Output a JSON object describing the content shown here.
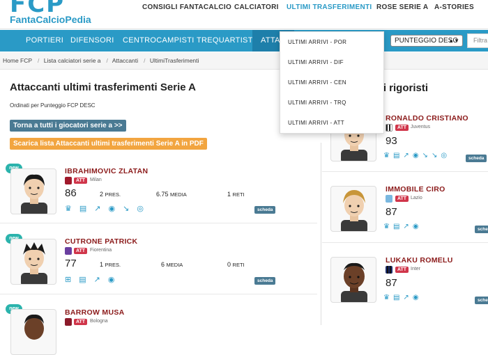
{
  "header": {
    "logo_mark": "FCP",
    "logo_text": "FantaCalcioPedia",
    "nav": [
      "CONSIGLI FANTACALCIO",
      "CALCIATORI",
      "ULTIMI TRASFERIMENTI",
      "ROSE SERIE A",
      "A-STORIES"
    ]
  },
  "positions": {
    "tabs": [
      "PORTIERI",
      "DIFENSORI",
      "CENTROCAMPISTI",
      "TREQUARTISTI",
      "ATTAC"
    ],
    "sort_value": "PUNTEGGIO DESC",
    "filter_placeholder": "Filtra"
  },
  "dropdown": {
    "items": [
      "ULTIMI ARRIVI - POR",
      "ULTIMI ARRIVI - DIF",
      "ULTIMI ARRIVI - CEN",
      "ULTIMI ARRIVI - TRQ",
      "ULTIMI ARRIVI - ATT"
    ]
  },
  "breadcrumb": [
    "Home FCP",
    "Lista calciatori serie a",
    "Attaccanti",
    "UltimiTrasferimenti"
  ],
  "main": {
    "title": "Attaccanti ultimi trasferimenti Serie A",
    "subtitle": "Ordinati per Punteggio FCP DESC",
    "back_button": "Torna a tutti i giocatori serie a >>",
    "download_button": "Scarica lista Attaccanti ultimi trasferimenti Serie A in PDF",
    "players": [
      {
        "badge": "new",
        "name": "IBRAHIMOVIC ZLATAN",
        "role": "ATT",
        "team": "Milan",
        "score": "86",
        "pres": "2",
        "pres_label": "PRES.",
        "media": "6.75",
        "media_label": "MEDIA",
        "reti": "1",
        "reti_label": "RETI",
        "scheda": "scheda",
        "shirt_color": "#a0192b"
      },
      {
        "badge": "new",
        "name": "CUTRONE PATRICK",
        "role": "ATT",
        "team": "Fiorentina",
        "score": "77",
        "pres": "1",
        "pres_label": "PRES.",
        "media": "6",
        "media_label": "MEDIA",
        "reti": "0",
        "reti_label": "RETI",
        "scheda": "scheda",
        "shirt_color": "#6a3fa0"
      },
      {
        "badge": "new",
        "name": "BARROW MUSA",
        "role": "ATT",
        "team": "Bologna",
        "shirt_color": "#8b1a2a"
      }
    ]
  },
  "sidebar": {
    "title": "ri rigoristi",
    "players": [
      {
        "name": "RONALDO CRISTIANO",
        "role": "ATT",
        "team": "Juventus",
        "score": "93",
        "scheda": "scheda",
        "shirt_color": "#333333"
      },
      {
        "name": "IMMOBILE CIRO",
        "role": "ATT",
        "team": "Lazio",
        "score": "87",
        "scheda": "scheda",
        "shirt_color": "#7ab8e0"
      },
      {
        "name": "LUKAKU ROMELU",
        "role": "ATT",
        "team": "Inter",
        "score": "87",
        "scheda": "scheda",
        "shirt_color": "#1a2a6a"
      }
    ]
  },
  "colors": {
    "accent": "#2a9ac6",
    "player_name": "#8b1a1a",
    "att_tag": "#d0354a",
    "new_badge": "#2bb3ac",
    "download": "#f2a540"
  }
}
